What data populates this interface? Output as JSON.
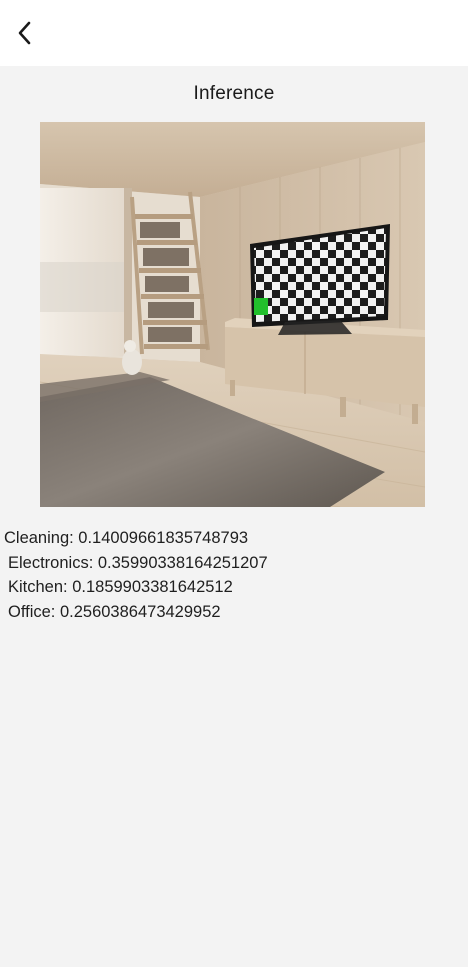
{
  "appbar": {
    "back_icon": "chevron-left-icon"
  },
  "page": {
    "title": "Inference"
  },
  "image": {
    "subject": "living-room-scene",
    "marker_color": "#22c02c"
  },
  "results": [
    {
      "text": "Cleaning: 0.14009661835748793"
    },
    {
      "text": "Electronics: 0.35990338164251207"
    },
    {
      "text": "Kitchen: 0.1859903381642512"
    },
    {
      "text": "Office: 0.2560386473429952"
    }
  ]
}
